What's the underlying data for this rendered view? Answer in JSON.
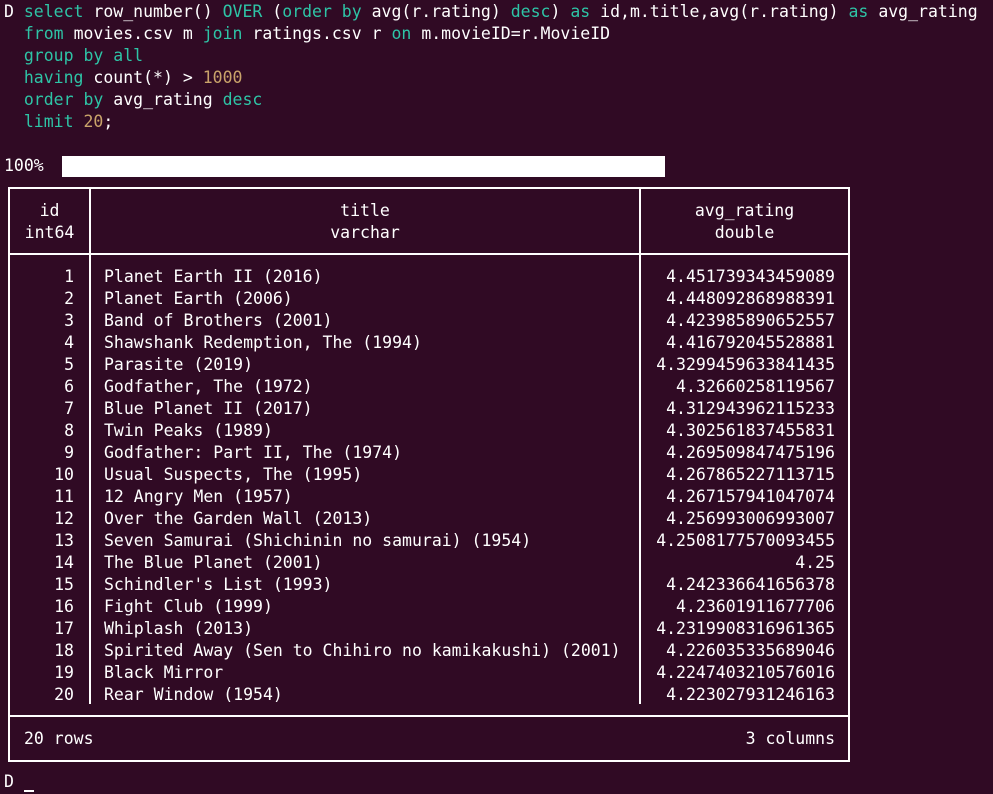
{
  "prompt": "D",
  "query": {
    "line1": {
      "kw_select": "select",
      "fn_row_number": "row_number()",
      "kw_over": "OVER",
      "paren_open": "(",
      "kw_order_by": "order by",
      "expr_avg": "avg(r.rating)",
      "kw_desc": "desc",
      "paren_close": ")",
      "kw_as": "as",
      "cols": "id,m.title,avg(r.rating)",
      "kw_as2": "as",
      "alias": "avg_rating"
    },
    "line2": {
      "kw_from": "from",
      "table1": "movies.csv",
      "alias_m": "m",
      "kw_join": "join",
      "table2": "ratings.csv",
      "alias_r": "r",
      "kw_on": "on",
      "cond": "m.movieID=r.MovieID"
    },
    "line3": {
      "kw_group_by": "group by",
      "kw_all": "all"
    },
    "line4": {
      "kw_having": "having",
      "expr": "count(*) >",
      "value": "1000"
    },
    "line5": {
      "kw_order_by": "order by",
      "col": "avg_rating",
      "kw_desc": "desc"
    },
    "line6": {
      "kw_limit": "limit",
      "value": "20",
      "semicolon": ";"
    }
  },
  "progress": {
    "label": "100%",
    "fraction": 1.0
  },
  "table": {
    "columns": [
      {
        "name": "id",
        "type": "int64"
      },
      {
        "name": "title",
        "type": "varchar"
      },
      {
        "name": "avg_rating",
        "type": "double"
      }
    ],
    "rows": [
      {
        "id": "1",
        "title": "Planet Earth II (2016)",
        "avg_rating": "4.451739343459089"
      },
      {
        "id": "2",
        "title": "Planet Earth (2006)",
        "avg_rating": "4.448092868988391"
      },
      {
        "id": "3",
        "title": "Band of Brothers (2001)",
        "avg_rating": "4.423985890652557"
      },
      {
        "id": "4",
        "title": "Shawshank Redemption, The (1994)",
        "avg_rating": "4.416792045528881"
      },
      {
        "id": "5",
        "title": "Parasite (2019)",
        "avg_rating": "4.3299459633841435"
      },
      {
        "id": "6",
        "title": "Godfather, The (1972)",
        "avg_rating": "4.32660258119567"
      },
      {
        "id": "7",
        "title": "Blue Planet II (2017)",
        "avg_rating": "4.312943962115233"
      },
      {
        "id": "8",
        "title": "Twin Peaks (1989)",
        "avg_rating": "4.302561837455831"
      },
      {
        "id": "9",
        "title": "Godfather: Part II, The (1974)",
        "avg_rating": "4.269509847475196"
      },
      {
        "id": "10",
        "title": "Usual Suspects, The (1995)",
        "avg_rating": "4.267865227113715"
      },
      {
        "id": "11",
        "title": "12 Angry Men (1957)",
        "avg_rating": "4.267157941047074"
      },
      {
        "id": "12",
        "title": "Over the Garden Wall (2013)",
        "avg_rating": "4.256993006993007"
      },
      {
        "id": "13",
        "title": "Seven Samurai (Shichinin no samurai) (1954)",
        "avg_rating": "4.2508177570093455"
      },
      {
        "id": "14",
        "title": "The Blue Planet (2001)",
        "avg_rating": "4.25"
      },
      {
        "id": "15",
        "title": "Schindler's List (1993)",
        "avg_rating": "4.242336641656378"
      },
      {
        "id": "16",
        "title": "Fight Club (1999)",
        "avg_rating": "4.23601911677706"
      },
      {
        "id": "17",
        "title": "Whiplash (2013)",
        "avg_rating": "4.2319908316961365"
      },
      {
        "id": "18",
        "title": "Spirited Away (Sen to Chihiro no kamikakushi) (2001)",
        "avg_rating": "4.226035335689046"
      },
      {
        "id": "19",
        "title": "Black Mirror",
        "avg_rating": "4.2247403210576016"
      },
      {
        "id": "20",
        "title": "Rear Window (1954)",
        "avg_rating": "4.223027931246163"
      }
    ],
    "footer": {
      "row_count": "20 rows",
      "col_count": "3 columns"
    }
  },
  "prompt_next": "D",
  "colors": {
    "background": "#300a24",
    "keyword": "#2ec4a6",
    "number": "#c9a36a",
    "text": "#ffffff"
  }
}
